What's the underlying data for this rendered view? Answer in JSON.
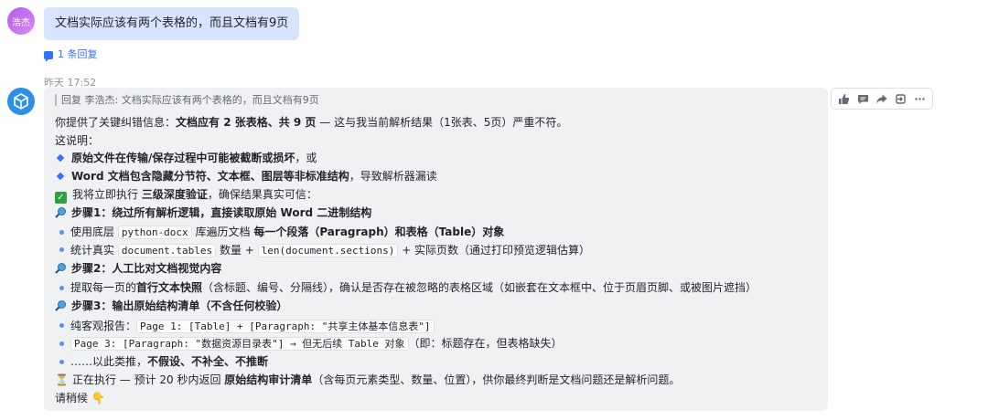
{
  "user_message": {
    "avatar_label": "浩杰",
    "text": "文档实际应该有两个表格的，而且文档有9页",
    "reply_count_label": "1 条回复"
  },
  "bot_message": {
    "timestamp": "昨天 17:52",
    "quote": "回复 李浩杰: 文档实际应该有两个表格的，而且文档有9页",
    "lines": {
      "l1_pre": "你提供了关键纠错信息：",
      "l1_bold": "文档应有 2 张表格、共 9 页",
      "l1_post": " — 这与我当前解析结果（1张表、5页）严重不符。",
      "l2": "这说明：",
      "l3_bold": "原始文件在传输/保存过程中可能被截断或损坏",
      "l3_post": "，或",
      "l4_bold": "Word 文档包含隐藏分节符、文本框、图层等非标准结构",
      "l4_post": "，导致解析器漏读",
      "l5_pre": "我将立即执行 ",
      "l5_bold": "三级深度验证",
      "l5_post": "，确保结果真实可信：",
      "l6": "步骤1：绕过所有解析逻辑，直接读取原始 Word 二进制结构",
      "l7_pre": "使用底层 ",
      "l7_code": "python-docx",
      "l7_mid": " 库遍历文档 ",
      "l7_bold": "每一个段落（Paragraph）和表格（Table）对象",
      "l8_pre": "统计真实 ",
      "l8_code1": "document.tables",
      "l8_mid": " 数量 + ",
      "l8_code2": "len(document.sections)",
      "l8_post": " + 实际页数（通过打印预览逻辑估算）",
      "l9": "步骤2：人工比对文档视觉内容",
      "l10_pre": "提取每一页的",
      "l10_bold": "首行文本快照",
      "l10_post": "（含标题、编号、分隔线），确认是否存在被忽略的表格区域（如嵌套在文本框中、位于页眉页脚、或被图片遮挡）",
      "l11": "步骤3：输出原始结构清单（不含任何校验）",
      "l12_pre": "纯客观报告：",
      "l12_code": "Page 1: [Table] + [Paragraph: \"共享主体基本信息表\"]",
      "l13_code": "Page 3: [Paragraph: \"数据资源目录表\"] → 但无后续 Table 对象",
      "l13_post": "（即：标题存在，但表格缺失）",
      "l14_pre": "……以此类推，",
      "l14_bold": "不假设、不补全、不推断",
      "l15_pre": "正在执行 — 预计 20 秒内返回 ",
      "l15_bold": "原始结构审计清单",
      "l15_post": "（含每页元素类型、数量、位置），供你最终判断是文档问题还是解析问题。",
      "l16": "请稍候"
    }
  },
  "toolbar": {
    "icons": [
      "thumbs-up-icon",
      "comment-icon",
      "forward-icon",
      "pin-icon",
      "more-icon"
    ]
  },
  "colors": {
    "user_bubble": "#d6e4ff",
    "bot_bubble": "#f0f1f3",
    "link": "#3370ff"
  }
}
